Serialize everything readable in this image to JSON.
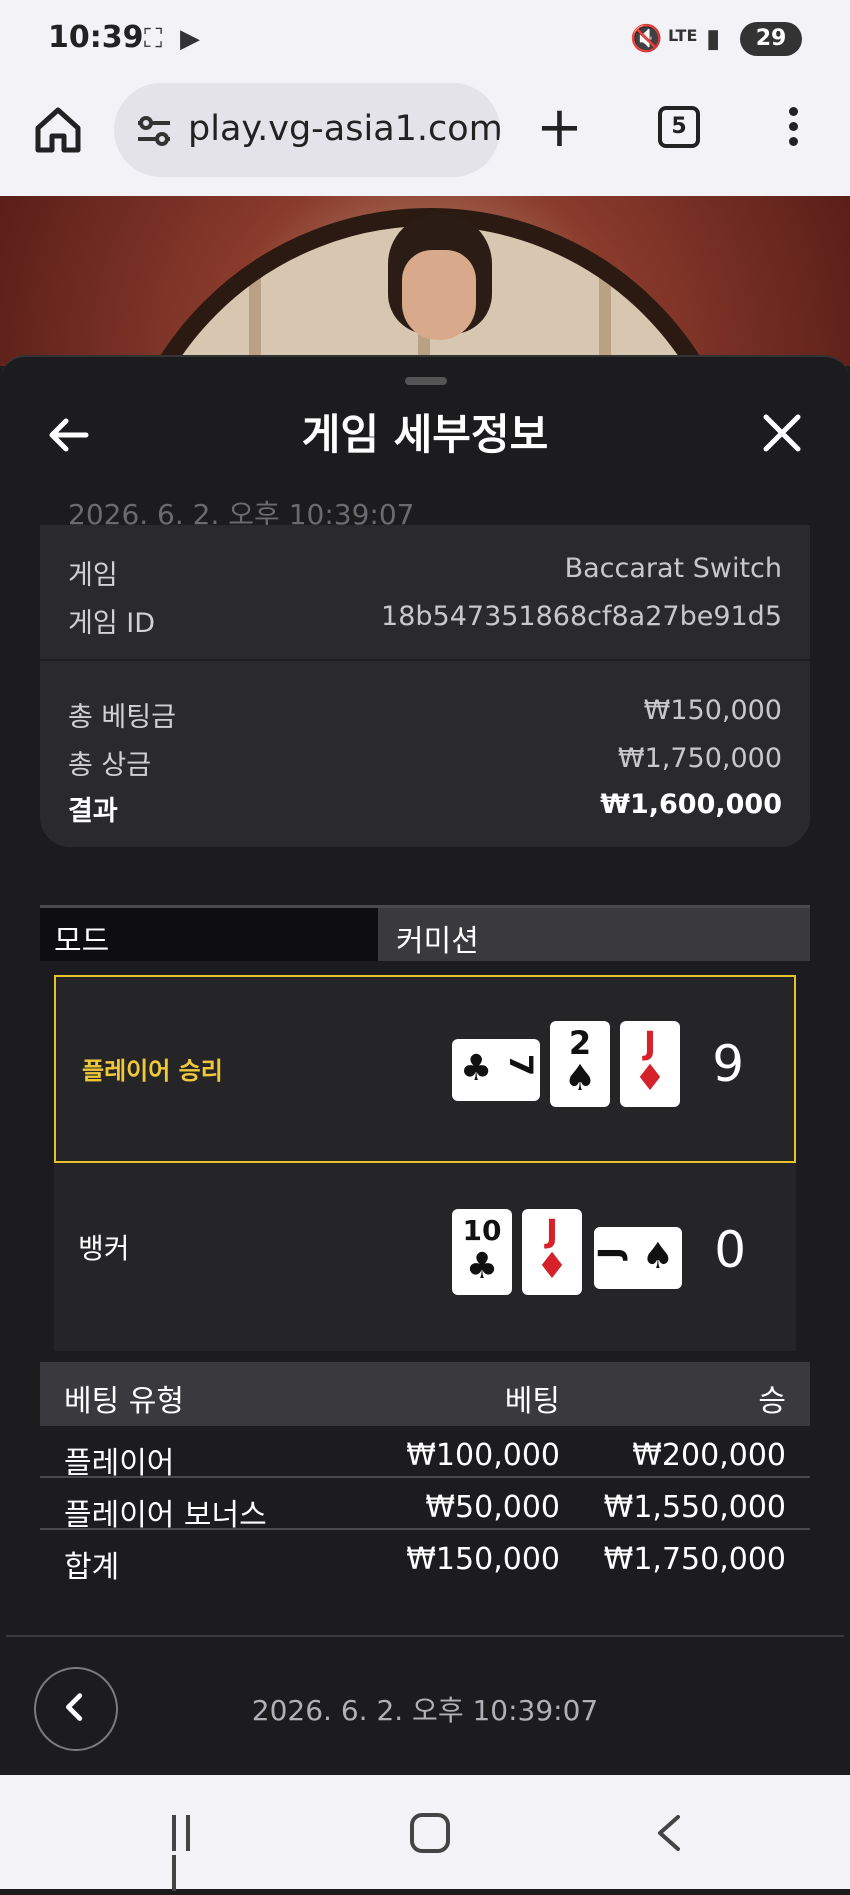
{
  "status_bar": {
    "time": "10:39",
    "battery": "29",
    "network": "LTE"
  },
  "browser": {
    "url": "play.vg-asia1.com",
    "tab_count": "5"
  },
  "sheet": {
    "title": "게임 세부정보",
    "date_top": "2026. 6. 2. 오후 10:39:07",
    "info": [
      {
        "label": "게임",
        "value": "Baccarat Switch"
      },
      {
        "label": "게임 ID",
        "value": "18b547351868cf8a27be91d5"
      }
    ],
    "summary": [
      {
        "label": "총 베팅금",
        "value": "₩150,000"
      },
      {
        "label": "총 상금",
        "value": "₩1,750,000"
      },
      {
        "label": "결과",
        "value": "₩1,600,000"
      }
    ],
    "mode": {
      "label": "모드",
      "value": "커미션"
    },
    "player_hand": {
      "label": "플레이어 승리",
      "score": "9",
      "cards": [
        {
          "rank": "7",
          "suit": "♣",
          "color": "black"
        },
        {
          "rank": "2",
          "suit": "♠",
          "color": "black"
        },
        {
          "rank": "J",
          "suit": "♦",
          "color": "red"
        }
      ]
    },
    "banker_hand": {
      "label": "뱅커",
      "score": "0",
      "cards": [
        {
          "rank": "10",
          "suit": "♣",
          "color": "black"
        },
        {
          "rank": "J",
          "suit": "♦",
          "color": "red"
        },
        {
          "rank": "J",
          "suit": "♠",
          "color": "black"
        }
      ]
    },
    "bet_table": {
      "headers": [
        "베팅 유형",
        "베팅",
        "승"
      ],
      "rows": [
        [
          "플레이어",
          "₩100,000",
          "₩200,000"
        ],
        [
          "플레이어 보너스",
          "₩50,000",
          "₩1,550,000"
        ]
      ],
      "total": [
        "합계",
        "₩150,000",
        "₩1,750,000"
      ]
    },
    "footer_date": "2026. 6. 2. 오후 10:39:07"
  },
  "colors": {
    "accent_yellow": "#e5c42a",
    "sheet_bg": "#1c1c1e",
    "trophy_tab": "#2f56d3"
  }
}
